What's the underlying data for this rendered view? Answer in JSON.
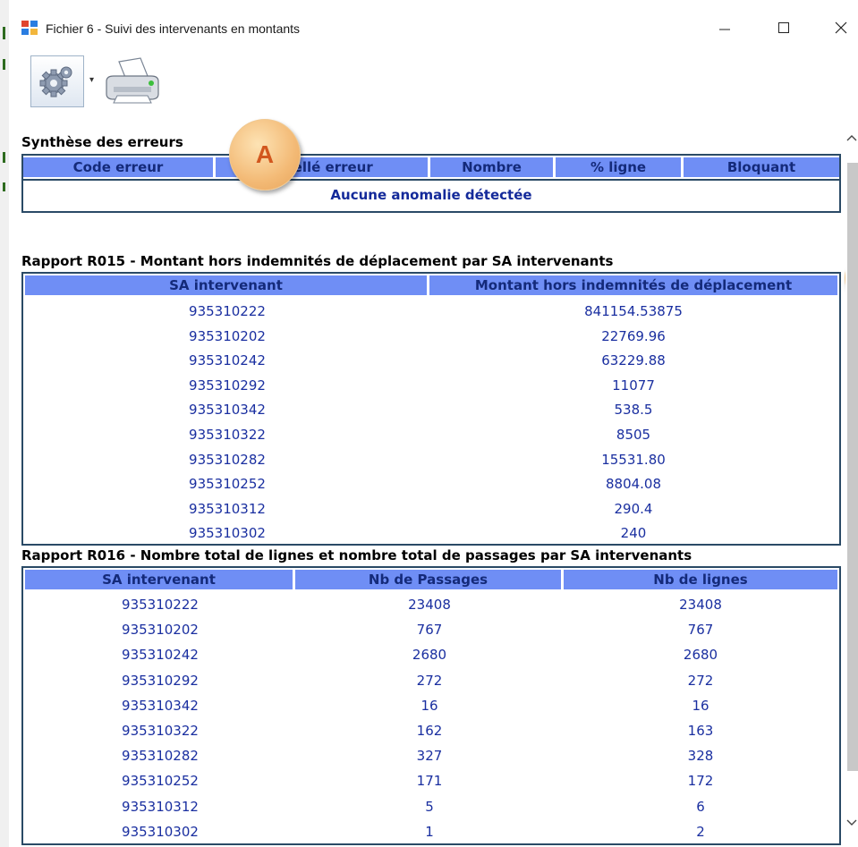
{
  "window": {
    "title": "Fichier 6 - Suivi des intervenants en montants",
    "minimize_icon": "minimize-icon",
    "maximize_icon": "maximize-icon",
    "close_icon": "close-icon"
  },
  "toolbar": {
    "settings_icon": "gear-icon",
    "dropdown_icon": "dropdown-arrow-icon",
    "print_icon": "printer-icon"
  },
  "errors_section": {
    "title": "Synthèse des erreurs",
    "headers": [
      "Code erreur",
      "Libellé erreur",
      "Nombre",
      "% ligne",
      "Bloquant"
    ],
    "empty_message": "Aucune anomalie détectée"
  },
  "annotation": {
    "label": "A",
    "color": "#f3ba76"
  },
  "r015": {
    "title": "Rapport R015 - Montant hors indemnités de déplacement par SA intervenants",
    "headers": [
      "SA intervenant",
      "Montant hors indemnités de déplacement"
    ],
    "rows": [
      [
        "935310222",
        "841154.53875"
      ],
      [
        "935310202",
        "22769.96"
      ],
      [
        "935310242",
        "63229.88"
      ],
      [
        "935310292",
        "11077"
      ],
      [
        "935310342",
        "538.5"
      ],
      [
        "935310322",
        "8505"
      ],
      [
        "935310282",
        "15531.80"
      ],
      [
        "935310252",
        "8804.08"
      ],
      [
        "935310312",
        "290.4"
      ],
      [
        "935310302",
        "240"
      ]
    ]
  },
  "r016": {
    "title": "Rapport R016 - Nombre total de lignes et nombre total de passages par SA intervenants",
    "headers": [
      "SA intervenant",
      "Nb de Passages",
      "Nb de lignes"
    ],
    "rows": [
      [
        "935310222",
        "23408",
        "23408"
      ],
      [
        "935310202",
        "767",
        "767"
      ],
      [
        "935310242",
        "2680",
        "2680"
      ],
      [
        "935310292",
        "272",
        "272"
      ],
      [
        "935310342",
        "16",
        "16"
      ],
      [
        "935310322",
        "162",
        "163"
      ],
      [
        "935310282",
        "327",
        "328"
      ],
      [
        "935310252",
        "171",
        "172"
      ],
      [
        "935310312",
        "5",
        "6"
      ],
      [
        "935310302",
        "1",
        "2"
      ]
    ]
  },
  "colors": {
    "header_bg": "#6f8ef5",
    "header_text": "#142a7a",
    "cell_text": "#1a2fa0",
    "border": "#2a4a66"
  }
}
